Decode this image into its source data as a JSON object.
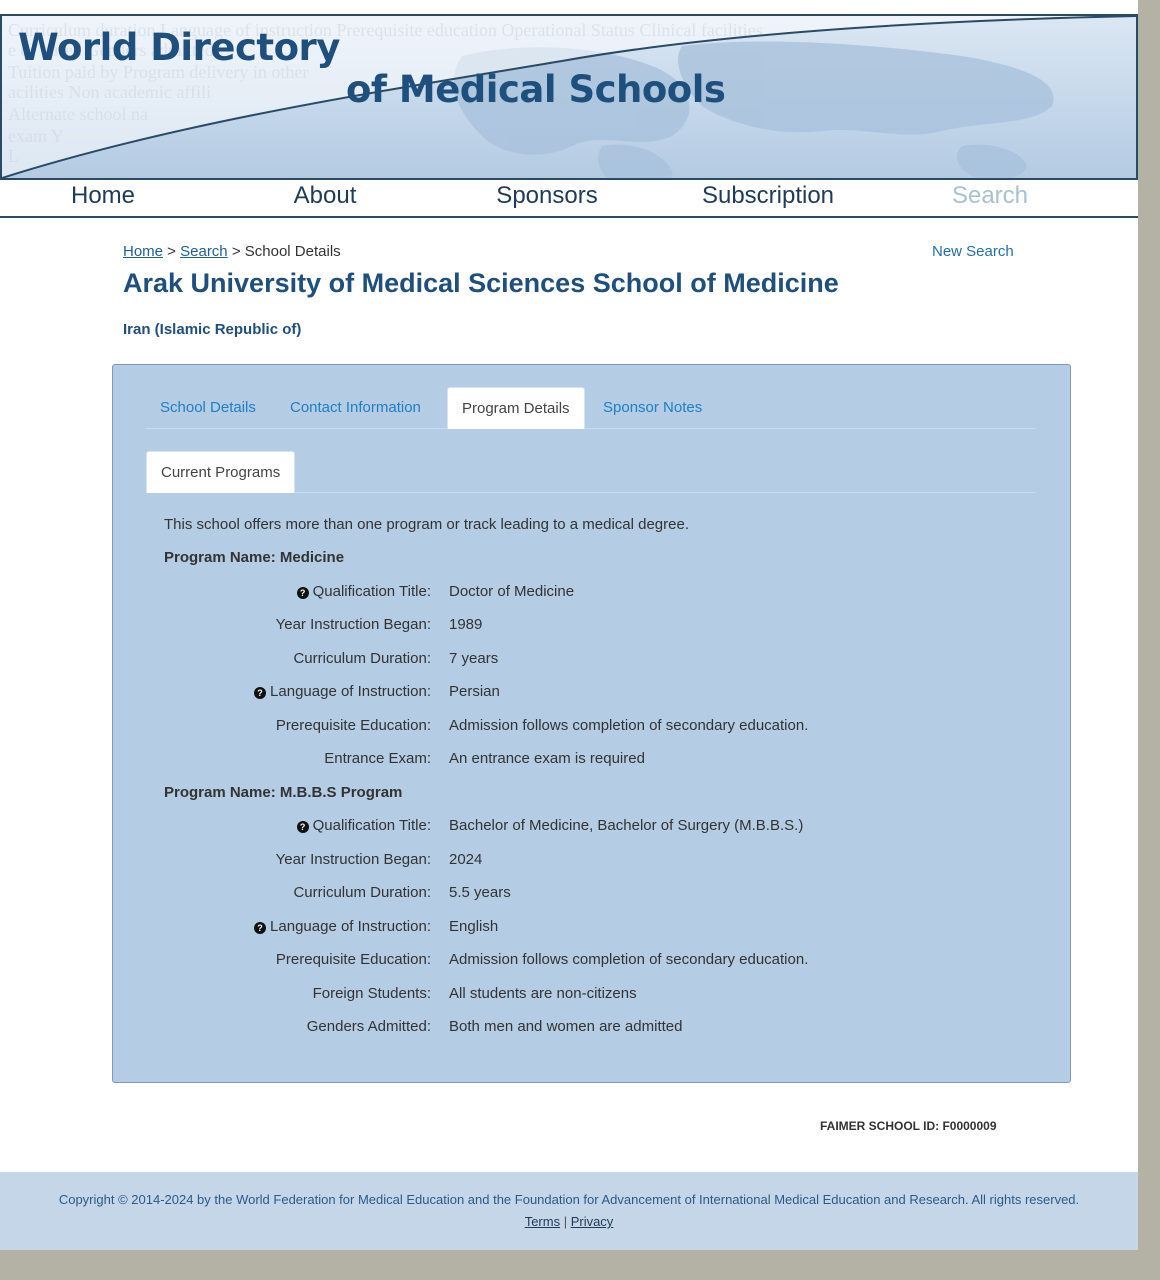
{
  "header": {
    "logo_line1": "World Directory",
    "logo_line2": "of Medical Schools",
    "ghost_text": [
      "Curriculum duration   Language of instruction   Prerequisite education   Operational Status   Clinical facilities",
      "e           ce                              tarted    Genders admitted",
      "Tuition paid by    Program delivery in other",
      "acilities   Non academic affili",
      "Alternate school na",
      "exam    Y",
      "L"
    ]
  },
  "nav": {
    "items": [
      {
        "label": "Home",
        "disabled": false
      },
      {
        "label": "About",
        "disabled": false
      },
      {
        "label": "Sponsors",
        "disabled": false
      },
      {
        "label": "Subscription",
        "disabled": false
      },
      {
        "label": "Search",
        "disabled": true
      }
    ]
  },
  "breadcrumb": {
    "home": "Home",
    "sep1": " > ",
    "search": "Search",
    "sep2": " > ",
    "current": "School Details"
  },
  "new_search": "New Search",
  "school": {
    "title": "Arak University of Medical Sciences School of Medicine",
    "country": "Iran (Islamic Republic of)"
  },
  "tabs": [
    "School Details",
    "Contact Information",
    "Program Details",
    "Sponsor Notes"
  ],
  "active_tab": "Program Details",
  "subtab": "Current Programs",
  "intro": "This school offers more than one program or track leading to a medical degree.",
  "programs": [
    {
      "name": "Program Name: Medicine",
      "fields": [
        {
          "label": "Qualification Title:",
          "value": "Doctor of Medicine",
          "help": true
        },
        {
          "label": "Year Instruction Began:",
          "value": "1989",
          "help": false
        },
        {
          "label": "Curriculum Duration:",
          "value": "7 years",
          "help": false
        },
        {
          "label": "Language of Instruction:",
          "value": "Persian",
          "help": true
        },
        {
          "label": "Prerequisite Education:",
          "value": "Admission follows completion of secondary education.",
          "help": false
        },
        {
          "label": "Entrance Exam:",
          "value": "An entrance exam is required",
          "help": false
        }
      ]
    },
    {
      "name": "Program Name: M.B.B.S Program",
      "fields": [
        {
          "label": "Qualification Title:",
          "value": "Bachelor of Medicine, Bachelor of Surgery (M.B.B.S.)",
          "help": true
        },
        {
          "label": "Year Instruction Began:",
          "value": "2024",
          "help": false
        },
        {
          "label": "Curriculum Duration:",
          "value": "5.5 years",
          "help": false
        },
        {
          "label": "Language of Instruction:",
          "value": "English",
          "help": true
        },
        {
          "label": "Prerequisite Education:",
          "value": "Admission follows completion of secondary education.",
          "help": false
        },
        {
          "label": "Foreign Students:",
          "value": "All students are non-citizens",
          "help": false
        },
        {
          "label": "Genders Admitted:",
          "value": "Both men and women are admitted",
          "help": false
        }
      ]
    }
  ],
  "faimer_id": "FAIMER SCHOOL ID: F0000009",
  "footer": {
    "copyright": "Copyright © 2014-2024 by the World Federation for Medical Education and the Foundation for Advancement of International Medical Education and Research. All rights reserved.",
    "terms": "Terms",
    "sep": " | ",
    "privacy": "Privacy"
  },
  "colors": {
    "brand_blue": "#1f4f7d",
    "link_blue": "#1f7fc4",
    "panel_bg": "#b4cce4",
    "footer_bg": "#c5d6e8"
  }
}
